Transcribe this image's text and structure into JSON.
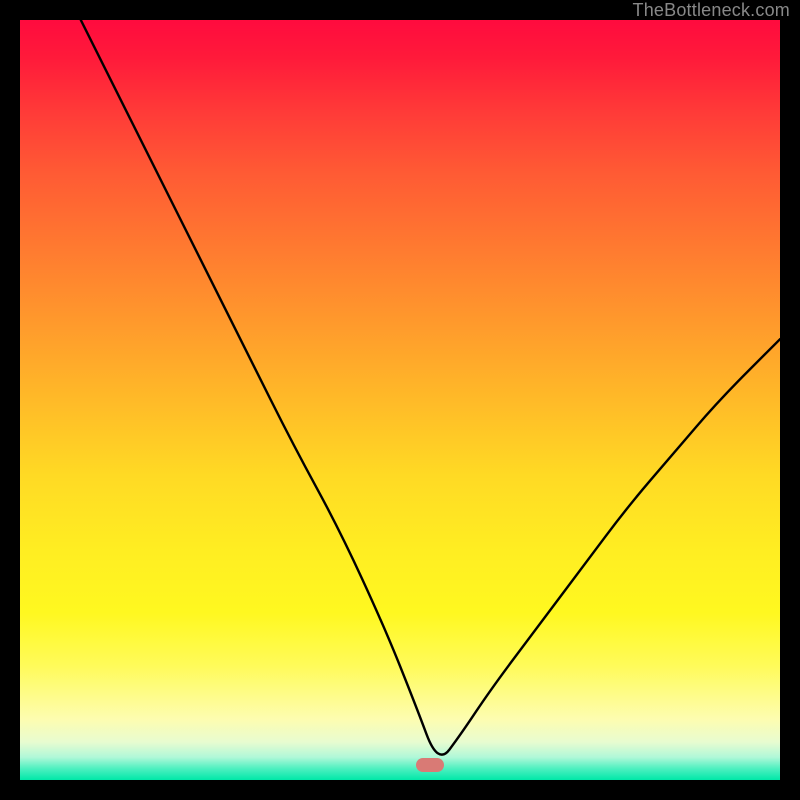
{
  "watermark": "TheBottleneck.com",
  "marker": {
    "x_frac": 0.54,
    "y_frac": 0.98,
    "w": 28,
    "h": 14,
    "color": "#d97a75"
  },
  "chart_data": {
    "type": "line",
    "title": "",
    "xlabel": "",
    "ylabel": "",
    "xlim": [
      0,
      100
    ],
    "ylim": [
      0,
      100
    ],
    "left_curve_desc": "steep convex descent from top-left to the minimum near x≈55, y≈2",
    "right_curve_desc": "convex ascent from the minimum to x=100, y≈60",
    "min_point": {
      "x": 55,
      "y": 2
    },
    "left_start": {
      "x": 8,
      "y": 100
    },
    "right_end": {
      "x": 100,
      "y": 58
    },
    "series": [
      {
        "name": "bottleneck-curve",
        "x": [
          8,
          12,
          18,
          24,
          30,
          36,
          42,
          48,
          52,
          55,
          58,
          62,
          68,
          74,
          80,
          86,
          92,
          100
        ],
        "y": [
          100,
          92,
          80,
          68,
          56,
          44,
          33,
          20,
          10,
          2,
          6,
          12,
          20,
          28,
          36,
          43,
          50,
          58
        ]
      }
    ],
    "background_gradient": {
      "top": "#ff0b3e",
      "mid_upper": "#ff7a30",
      "mid_lower": "#ffee22",
      "near_bottom": "#fdfdb0",
      "bottom": "#00e8a8"
    }
  }
}
